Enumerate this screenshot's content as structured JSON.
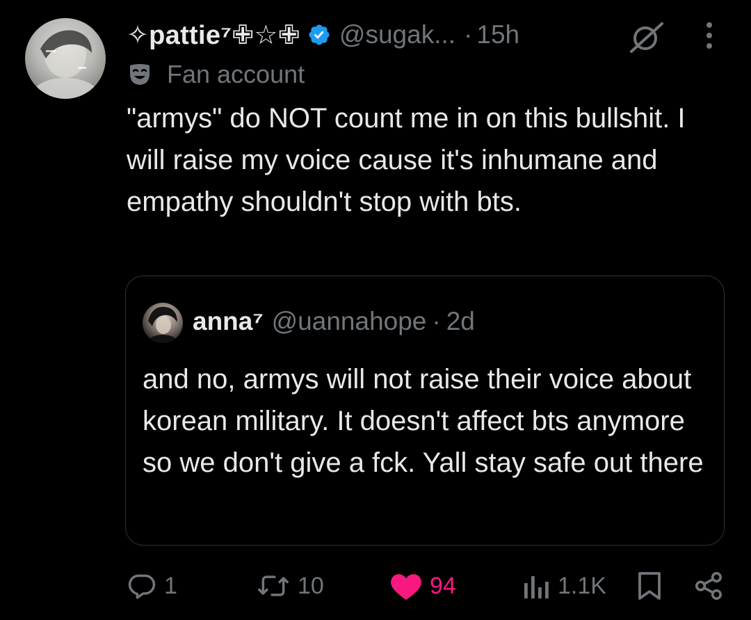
{
  "author": {
    "display_name": "✧pattie⁷✙☆✙",
    "handle": "@sugak...",
    "separator": "·",
    "time": "15h",
    "label": "Fan account"
  },
  "tweet": {
    "text": "\"armys\" do NOT count me in on this bullshit. I will raise my voice cause it's inhumane and empathy shouldn't stop with bts."
  },
  "quote": {
    "display_name": "anna⁷",
    "handle": "@uannahope",
    "separator": "·",
    "time": "2d",
    "text": "and no, armys will not raise their voice about korean military. It doesn't affect bts anymore so we don't give a fck. Yall stay safe out there"
  },
  "actions": {
    "replies": "1",
    "reposts": "10",
    "likes": "94",
    "views": "1.1K"
  },
  "icons": {
    "verified": "verified-badge-icon",
    "grok": "grok-icon",
    "more": "more-vertical-icon",
    "label": "theater-mask-icon",
    "reply": "reply-icon",
    "repost": "repost-icon",
    "like": "heart-icon",
    "views": "analytics-icon",
    "bookmark": "bookmark-icon",
    "share": "share-icon"
  },
  "colors": {
    "background": "#000000",
    "text_primary": "#e7e9ea",
    "text_secondary": "#71767b",
    "verified": "#1d9bf0",
    "like_active": "#f91880",
    "border": "#2f3336"
  }
}
